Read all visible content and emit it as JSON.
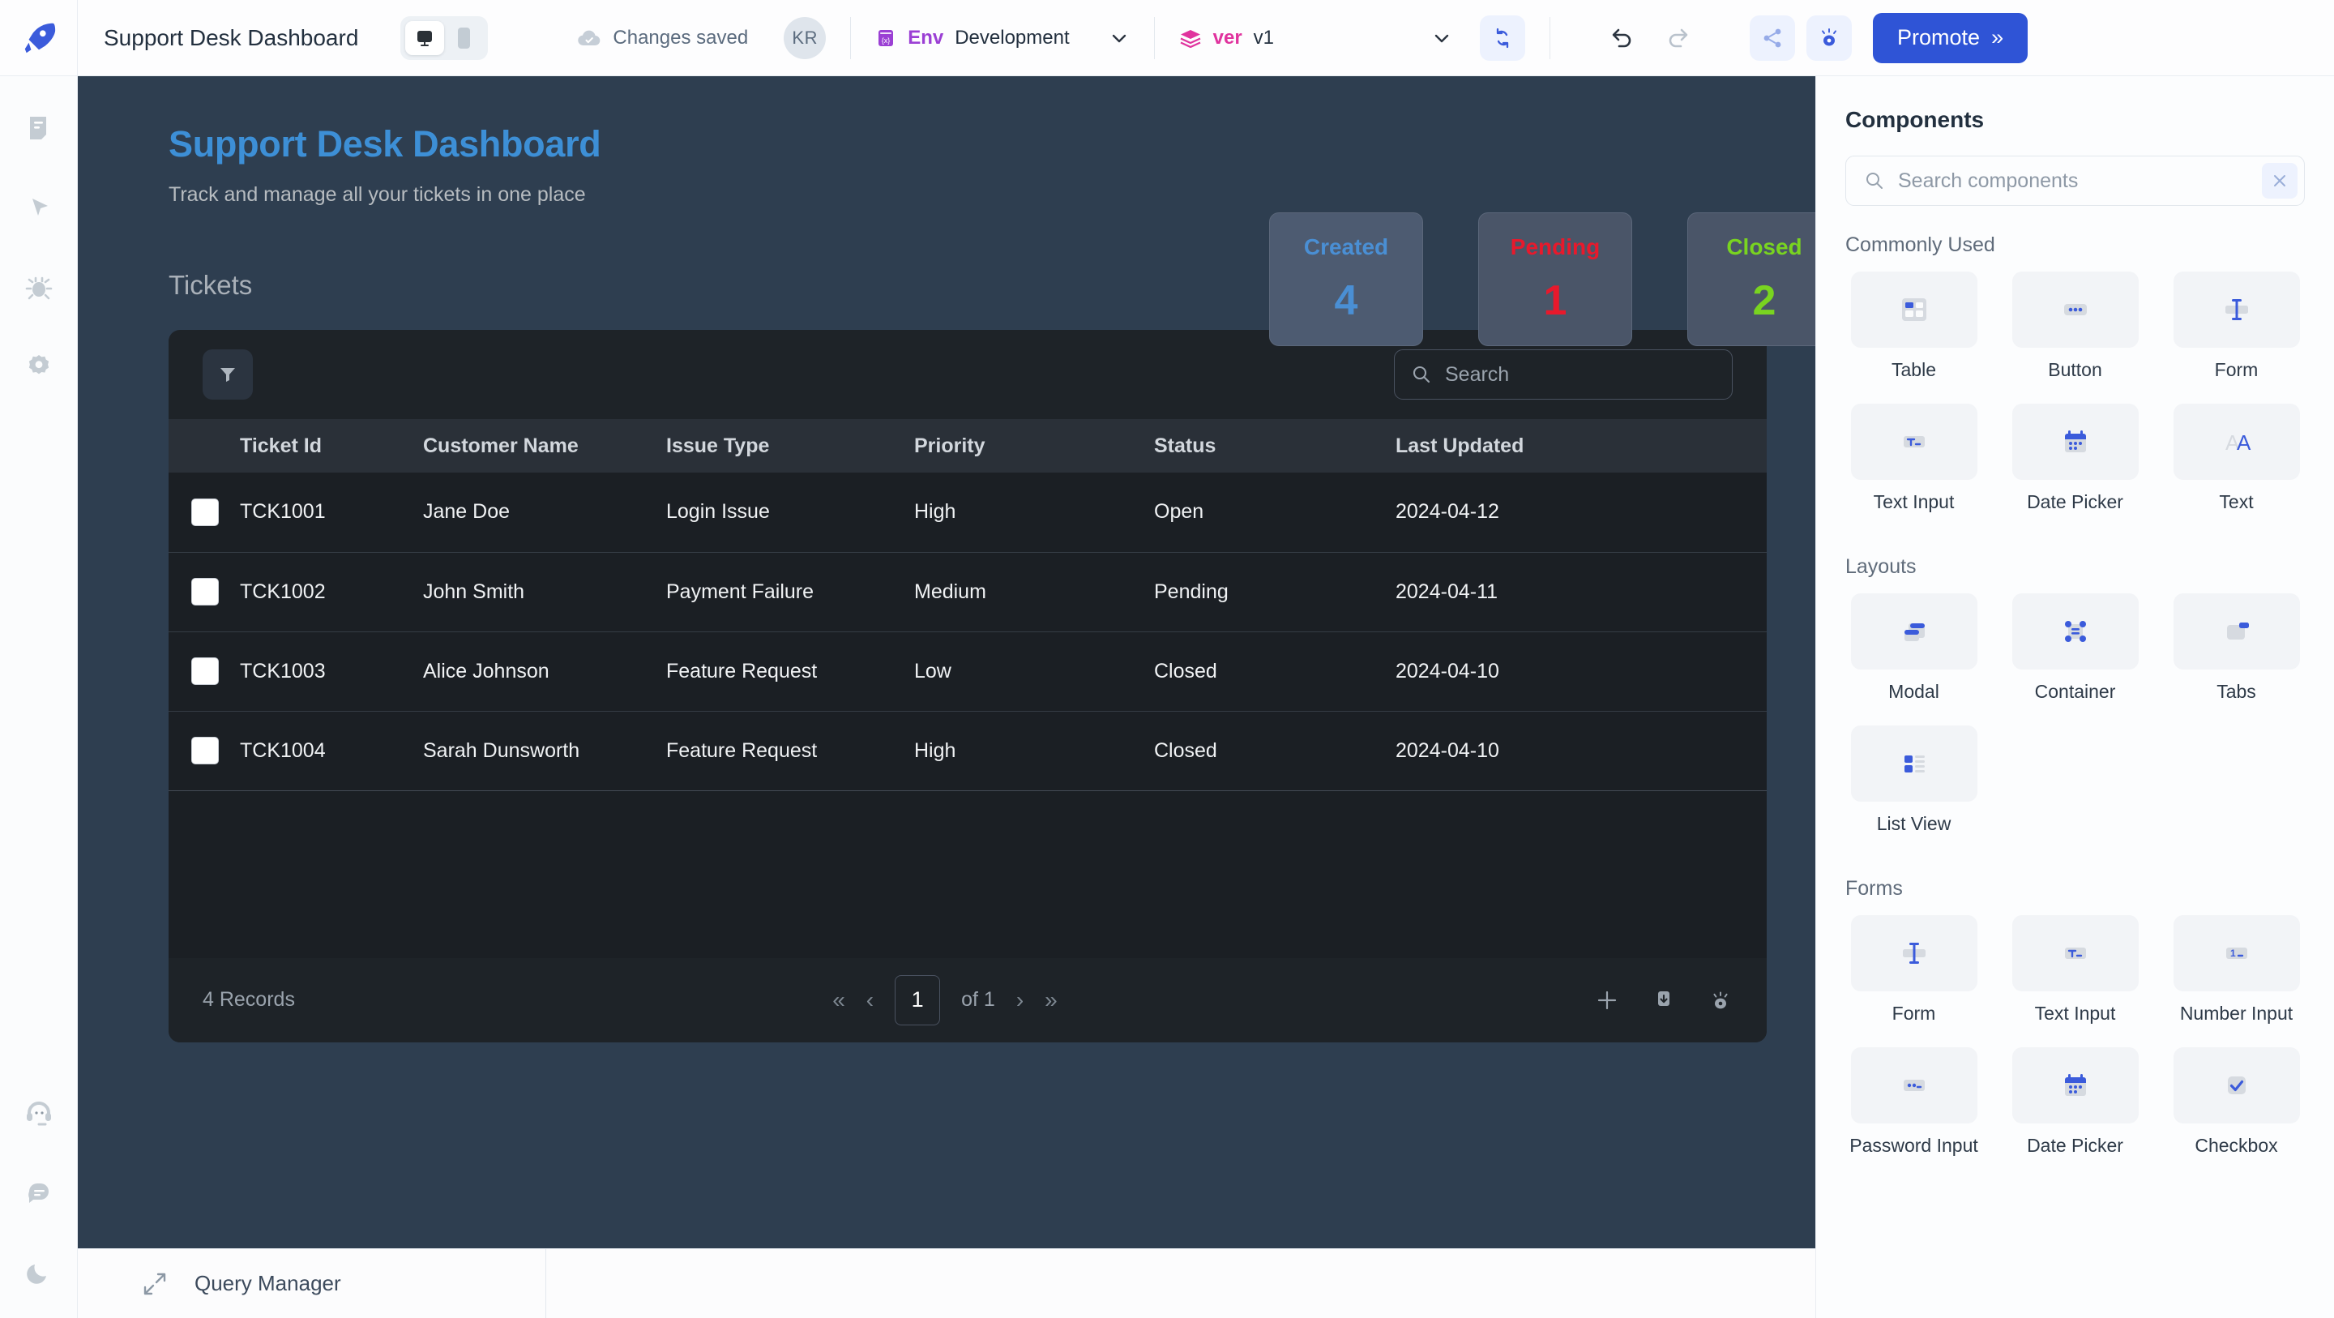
{
  "topbar": {
    "app_title": "Support Desk Dashboard",
    "devices": [
      {
        "name": "desktop-view",
        "icon": "monitor-icon",
        "active": true
      },
      {
        "name": "mobile-view",
        "icon": "phone-icon",
        "active": false
      }
    ],
    "save_status": "Changes saved",
    "avatar_initials": "KR",
    "env": {
      "tag": "Env",
      "value": "Development",
      "tag_color": "#9b3fd4"
    },
    "version": {
      "tag": "ver",
      "value": "v1",
      "tag_color": "#e0339e"
    },
    "promote_label": "Promote",
    "promote_chevrons": "»",
    "promote_color": "#2f54d6"
  },
  "rail": {
    "items": [
      {
        "label": "pages",
        "icon": "pages-icon"
      },
      {
        "label": "inspector",
        "icon": "cursor-icon"
      },
      {
        "label": "debugger",
        "icon": "bug-icon"
      },
      {
        "label": "settings",
        "icon": "gear-icon"
      }
    ],
    "bottom_items": [
      {
        "label": "support",
        "icon": "headset-icon"
      },
      {
        "label": "chat",
        "icon": "chat-icon"
      },
      {
        "label": "theme",
        "icon": "moon-icon"
      }
    ]
  },
  "canvas": {
    "heading": "Support Desk Dashboard",
    "subheading": "Track and manage all your tickets in one place",
    "heading_color": "#3d8fd6",
    "stats": [
      {
        "label": "Created",
        "value": "4",
        "color": "#4a8fd4"
      },
      {
        "label": "Pending",
        "value": "1",
        "color": "#e8192c"
      },
      {
        "label": "Closed",
        "value": "2",
        "color": "#79d420"
      }
    ],
    "section_label": "Tickets",
    "table": {
      "search_placeholder": "Search",
      "columns": [
        "Ticket Id",
        "Customer Name",
        "Issue Type",
        "Priority",
        "Status",
        "Last Updated"
      ],
      "rows": [
        {
          "ticket_id": "TCK1001",
          "customer": "Jane Doe",
          "issue": "Login Issue",
          "priority": "High",
          "status": "Open",
          "updated": "2024-04-12"
        },
        {
          "ticket_id": "TCK1002",
          "customer": "John Smith",
          "issue": "Payment Failure",
          "priority": "Medium",
          "status": "Pending",
          "updated": "2024-04-11"
        },
        {
          "ticket_id": "TCK1003",
          "customer": "Alice Johnson",
          "issue": "Feature Request",
          "priority": "Low",
          "status": "Closed",
          "updated": "2024-04-10"
        },
        {
          "ticket_id": "TCK1004",
          "customer": "Sarah Dunsworth",
          "issue": "Feature Request",
          "priority": "High",
          "status": "Closed",
          "updated": "2024-04-10"
        }
      ],
      "records_label": "4 Records",
      "page_number": "1",
      "page_of": "of 1"
    }
  },
  "querybar": {
    "label": "Query Manager"
  },
  "panel": {
    "title": "Components",
    "search_placeholder": "Search components",
    "groups": [
      {
        "label": "Commonly Used",
        "items": [
          {
            "name": "Table",
            "icon": "table-icon"
          },
          {
            "name": "Button",
            "icon": "button-icon"
          },
          {
            "name": "Form",
            "icon": "form-icon"
          },
          {
            "name": "Text Input",
            "icon": "text-input-icon"
          },
          {
            "name": "Date Picker",
            "icon": "calendar-icon"
          },
          {
            "name": "Text",
            "icon": "text-icon"
          }
        ]
      },
      {
        "label": "Layouts",
        "items": [
          {
            "name": "Modal",
            "icon": "modal-icon"
          },
          {
            "name": "Container",
            "icon": "container-icon"
          },
          {
            "name": "Tabs",
            "icon": "tabs-icon"
          },
          {
            "name": "List View",
            "icon": "list-view-icon"
          }
        ]
      },
      {
        "label": "Forms",
        "items": [
          {
            "name": "Form",
            "icon": "form-icon"
          },
          {
            "name": "Text Input",
            "icon": "text-input-icon"
          },
          {
            "name": "Number Input",
            "icon": "number-input-icon"
          },
          {
            "name": "Password Input",
            "icon": "password-input-icon"
          },
          {
            "name": "Date Picker",
            "icon": "calendar-icon"
          },
          {
            "name": "Checkbox",
            "icon": "checkbox-icon"
          }
        ]
      }
    ]
  }
}
